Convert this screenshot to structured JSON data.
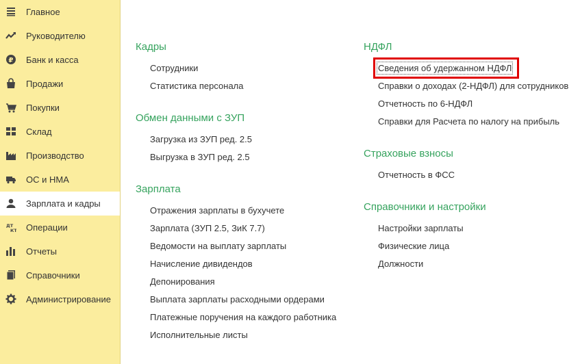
{
  "sidebar": {
    "items": [
      {
        "label": "Главное",
        "icon": "menu-lines-icon"
      },
      {
        "label": "Руководителю",
        "icon": "trend-line-icon"
      },
      {
        "label": "Банк и касса",
        "icon": "ruble-coin-icon"
      },
      {
        "label": "Продажи",
        "icon": "shopping-bag-icon"
      },
      {
        "label": "Покупки",
        "icon": "shopping-cart-icon"
      },
      {
        "label": "Склад",
        "icon": "warehouse-grid-icon"
      },
      {
        "label": "Производство",
        "icon": "factory-icon"
      },
      {
        "label": "ОС и НМА",
        "icon": "truck-icon"
      },
      {
        "label": "Зарплата и кадры",
        "icon": "person-icon"
      },
      {
        "label": "Операции",
        "icon": "debit-credit-icon"
      },
      {
        "label": "Отчеты",
        "icon": "bar-chart-icon"
      },
      {
        "label": "Справочники",
        "icon": "books-icon"
      },
      {
        "label": "Администрирование",
        "icon": "gear-icon"
      }
    ],
    "active_index": 8,
    "colors": {
      "background": "#fbed9e",
      "active": "#ffffff"
    }
  },
  "sections": {
    "kadry": {
      "title": "Кадры",
      "links": [
        "Сотрудники",
        "Статистика персонала"
      ]
    },
    "obmen": {
      "title": "Обмен данными с ЗУП",
      "links": [
        "Загрузка из ЗУП ред. 2.5",
        "Выгрузка в ЗУП ред. 2.5"
      ]
    },
    "zarplata": {
      "title": "Зарплата",
      "links": [
        "Отражения зарплаты в бухучете",
        "Зарплата (ЗУП 2.5, ЗиК 7.7)",
        "Ведомости на выплату зарплаты",
        "Начисление дивидендов",
        "Депонирования",
        "Выплата зарплаты расходными ордерами",
        "Платежные поручения на каждого работника",
        "Исполнительные листы"
      ]
    },
    "ndfl": {
      "title": "НДФЛ",
      "links": [
        "Сведения об удержанном НДФЛ",
        "Справки о доходах (2-НДФЛ) для сотрудников",
        "Отчетность по 6-НДФЛ",
        "Справки для Расчета по налогу на прибыль"
      ]
    },
    "strakh": {
      "title": "Страховые взносы",
      "links": [
        "Отчетность в ФСС"
      ]
    },
    "sprav": {
      "title": "Справочники и настройки",
      "links": [
        "Настройки зарплаты",
        "Физические лица",
        "Должности"
      ]
    }
  },
  "colors": {
    "section_title": "#36a35e",
    "highlight": "#e00000"
  }
}
